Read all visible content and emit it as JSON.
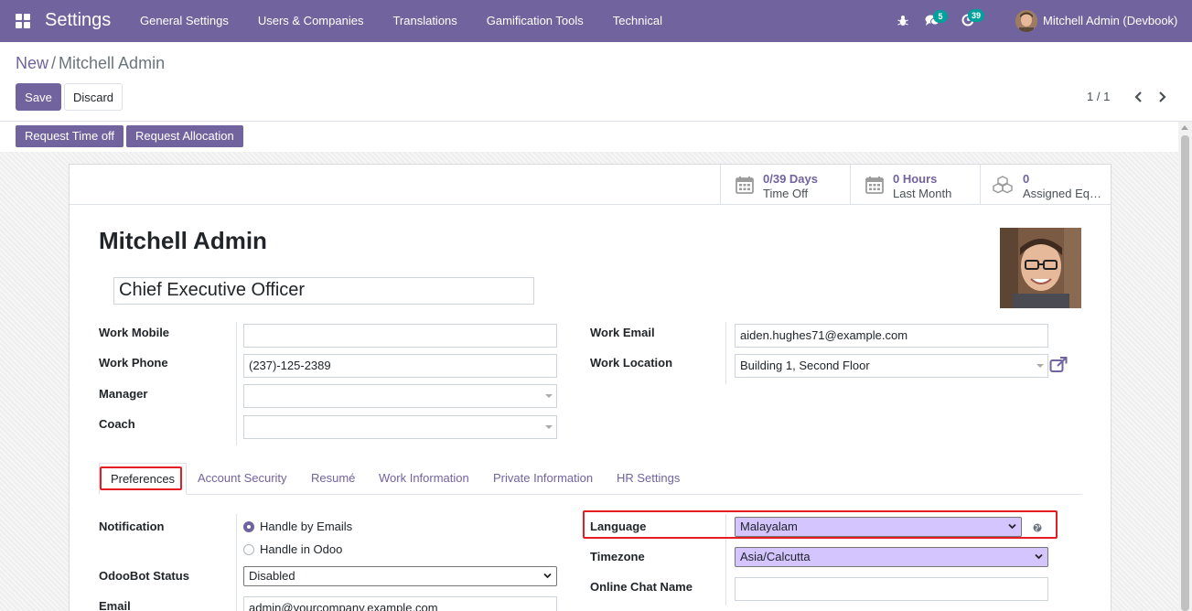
{
  "navbar": {
    "brand": "Settings",
    "menu": [
      "General Settings",
      "Users & Companies",
      "Translations",
      "Gamification Tools",
      "Technical"
    ],
    "messages_count": "5",
    "activities_count": "39",
    "user_name": "Mitchell Admin (Devbook)"
  },
  "breadcrumb": {
    "parent": "New",
    "separator": "/",
    "current": "Mitchell Admin"
  },
  "actions": {
    "save": "Save",
    "discard": "Discard"
  },
  "pager": {
    "value": "1 / 1"
  },
  "header_buttons": {
    "request_time_off": "Request Time off",
    "request_allocation": "Request Allocation"
  },
  "stat_buttons": {
    "time_off": {
      "value": "0/39 Days",
      "label": "Time Off"
    },
    "hours": {
      "value": "0 Hours",
      "label": "Last Month"
    },
    "equipment": {
      "value": "0",
      "label": "Assigned Equipment"
    }
  },
  "employee": {
    "name": "Mitchell Admin",
    "job_title": "Chief Executive Officer"
  },
  "fields": {
    "work_mobile": {
      "label": "Work Mobile",
      "value": ""
    },
    "work_phone": {
      "label": "Work Phone",
      "value": "(237)-125-2389"
    },
    "manager": {
      "label": "Manager",
      "value": ""
    },
    "coach": {
      "label": "Coach",
      "value": ""
    },
    "work_email": {
      "label": "Work Email",
      "value": "aiden.hughes71@example.com"
    },
    "work_location": {
      "label": "Work Location",
      "value": "Building 1, Second Floor"
    }
  },
  "tabs": [
    "Preferences",
    "Account Security",
    "Resumé",
    "Work Information",
    "Private Information",
    "HR Settings"
  ],
  "preferences": {
    "notification": {
      "label": "Notification",
      "options": [
        "Handle by Emails",
        "Handle in Odoo"
      ],
      "selected": "Handle by Emails"
    },
    "odoobot_status": {
      "label": "OdooBot Status",
      "value": "Disabled"
    },
    "email": {
      "label": "Email",
      "value": "admin@yourcompany.example.com"
    },
    "language": {
      "label": "Language",
      "value": "Malayalam"
    },
    "timezone": {
      "label": "Timezone",
      "value": "Asia/Calcutta"
    },
    "online_chat_name": {
      "label": "Online Chat Name",
      "value": ""
    }
  },
  "colors": {
    "brand": "#71639e",
    "highlight": "#e51e25",
    "badge": "#00a09d",
    "select_fill": "#d5c5ff"
  }
}
